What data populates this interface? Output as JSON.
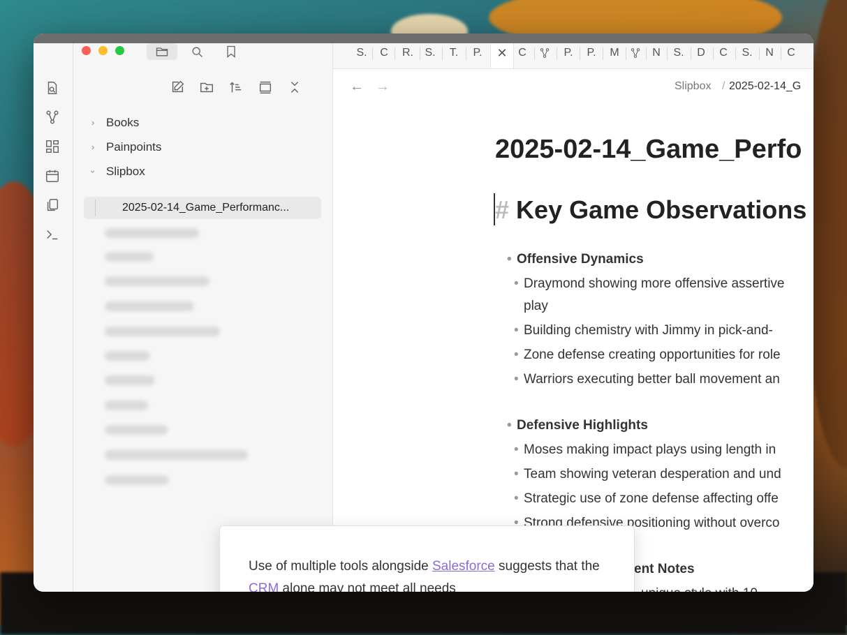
{
  "sidebar": {
    "tree": [
      {
        "label": "Books",
        "expanded": false
      },
      {
        "label": "Painpoints",
        "expanded": false
      },
      {
        "label": "Slipbox",
        "expanded": true
      }
    ],
    "active_file": "2025-02-14_Game_Performanc..."
  },
  "tabs": [
    "S.",
    "C",
    "R.",
    "S.",
    "T.",
    "P.",
    "C",
    "P.",
    "P.",
    "M",
    "N",
    "S.",
    "D",
    "C",
    "S.",
    "N",
    "C"
  ],
  "tab_close": "✕",
  "breadcrumb": {
    "folder": "Slipbox",
    "sep": "/",
    "file": "2025-02-14_G"
  },
  "doc": {
    "title": "2025-02-14_Game_Perfo",
    "h1_hash": "#",
    "h1": "Key Game Observations",
    "sections": [
      {
        "heading": "Offensive Dynamics",
        "items": [
          "Draymond showing more offensive assertive",
          "play",
          "Building chemistry with Jimmy in pick-and-",
          "Zone defense creating opportunities for role",
          "Warriors executing better ball movement an"
        ]
      },
      {
        "heading": "Defensive Highlights",
        "items": [
          "Moses making impact plays using length in",
          "Team showing veteran desperation and und",
          "Strategic use of zone defense affecting offe",
          "Strong defensive positioning without overco"
        ]
      }
    ],
    "section3_tail": "ent Notes",
    "section3_line": "unique style with 10"
  },
  "popover": {
    "pre": "Use of multiple tools alongside ",
    "link1": "Salesforce",
    "mid": " suggests that the ",
    "link2": "CRM",
    "post": " alone may not meet all needs"
  },
  "icons": {
    "ribbon": [
      "open-quick-switcher-icon",
      "graph-view-icon",
      "canvas-icon",
      "daily-note-icon",
      "templates-icon",
      "terminal-icon"
    ],
    "sidebar_header": [
      "file-explorer-icon",
      "search-icon",
      "bookmark-icon",
      "sidebar-toggle-icon"
    ],
    "nav_actions": [
      "new-note-icon",
      "new-folder-icon",
      "sort-icon",
      "collapse-view-icon",
      "collapse-all-icon"
    ]
  }
}
